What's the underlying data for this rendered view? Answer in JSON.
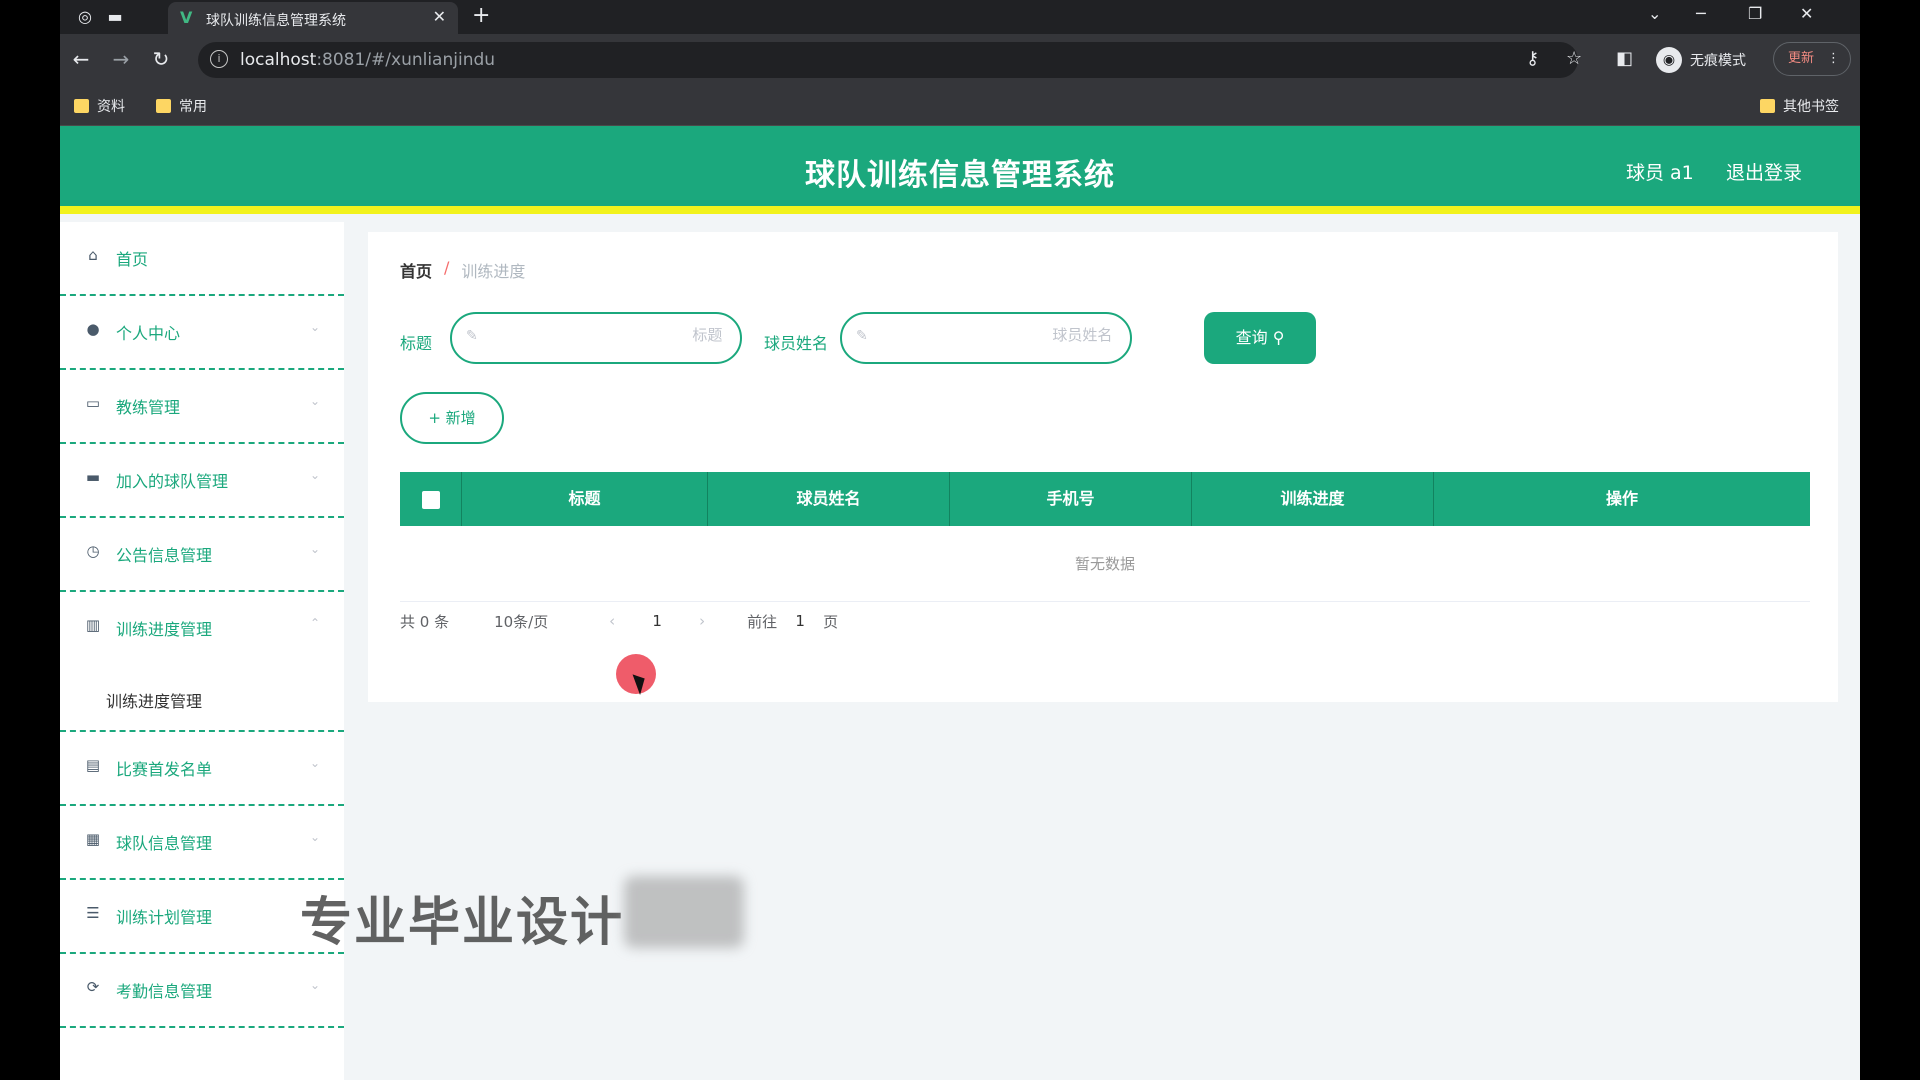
{
  "browser": {
    "tab_title": "球队训练信息管理系统",
    "url_host": "localhost",
    "url_rest": ":8081/#/xunlianjindu",
    "incognito_label": "无痕模式",
    "update_label": "更新",
    "bookmarks": [
      "资料",
      "常用"
    ],
    "other_bookmarks": "其他书签"
  },
  "header": {
    "title": "球队训练信息管理系统",
    "user": "球员 a1",
    "logout": "退出登录"
  },
  "sidebar": {
    "items": [
      {
        "label": "首页",
        "icon": "home-icon"
      },
      {
        "label": "个人中心",
        "icon": "user-icon"
      },
      {
        "label": "教练管理",
        "icon": "id-card-icon"
      },
      {
        "label": "加入的球队管理",
        "icon": "flag-icon"
      },
      {
        "label": "公告信息管理",
        "icon": "clock-icon"
      },
      {
        "label": "训练进度管理",
        "icon": "bar-chart-icon"
      },
      {
        "label": "比赛首发名单",
        "icon": "briefcase-icon"
      },
      {
        "label": "球队信息管理",
        "icon": "building-icon"
      },
      {
        "label": "训练计划管理",
        "icon": "list-icon"
      },
      {
        "label": "考勤信息管理",
        "icon": "refresh-icon"
      }
    ],
    "submenu": "训练进度管理"
  },
  "breadcrumb": {
    "home": "首页",
    "sep": "/",
    "current": "训练进度"
  },
  "filters": {
    "title_label": "标题",
    "title_placeholder": "标题",
    "name_label": "球员姓名",
    "name_placeholder": "球员姓名",
    "search_label": "查询"
  },
  "add_label": "+ 新增",
  "table": {
    "columns": [
      "标题",
      "球员姓名",
      "手机号",
      "训练进度",
      "操作"
    ],
    "empty_text": "暂无数据"
  },
  "pager": {
    "total": "共 0 条",
    "page_size": "10条/页",
    "current_page": "1",
    "goto_label": "前往",
    "goto_value": "1",
    "page_suffix": "页"
  },
  "watermark": "专业毕业设计"
}
